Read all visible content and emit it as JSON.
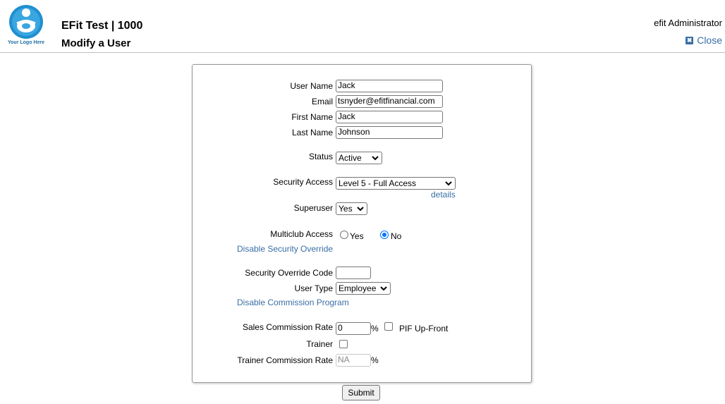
{
  "header": {
    "logo_text": "Your Logo Here",
    "app_title": "EFit Test | 1000",
    "page_title": "Modify a User",
    "current_user": "efit Administrator",
    "close_label": "Close"
  },
  "form": {
    "user_name": {
      "label": "User Name",
      "value": "Jack"
    },
    "email": {
      "label": "Email",
      "value": "tsnyder@efitfinancial.com"
    },
    "first_name": {
      "label": "First Name",
      "value": "Jack"
    },
    "last_name": {
      "label": "Last Name",
      "value": "Johnson"
    },
    "status": {
      "label": "Status",
      "value": "Active"
    },
    "security_access": {
      "label": "Security Access",
      "value": "Level 5 - Full Access",
      "details_label": "details"
    },
    "superuser": {
      "label": "Superuser",
      "value": "Yes"
    },
    "multiclub": {
      "label": "Multiclub Access",
      "yes_label": "Yes",
      "no_label": "No",
      "selected": "No"
    },
    "disable_security_override_label": "Disable Security Override",
    "security_override_code": {
      "label": "Security Override Code",
      "value": ""
    },
    "user_type": {
      "label": "User Type",
      "value": "Employee"
    },
    "disable_commission_label": "Disable Commission Program",
    "sales_commission": {
      "label": "Sales Commission Rate",
      "value": "0",
      "unit": "%",
      "pif_label": "PIF Up-Front",
      "pif_checked": false
    },
    "trainer": {
      "label": "Trainer",
      "checked": false
    },
    "trainer_commission": {
      "label": "Trainer Commission Rate",
      "placeholder": "NA",
      "unit": "%"
    },
    "submit_label": "Submit"
  },
  "colors": {
    "link": "#3a6ea5",
    "radio_selected": "#0075ff",
    "logo_blue": "#1f8fd0"
  }
}
